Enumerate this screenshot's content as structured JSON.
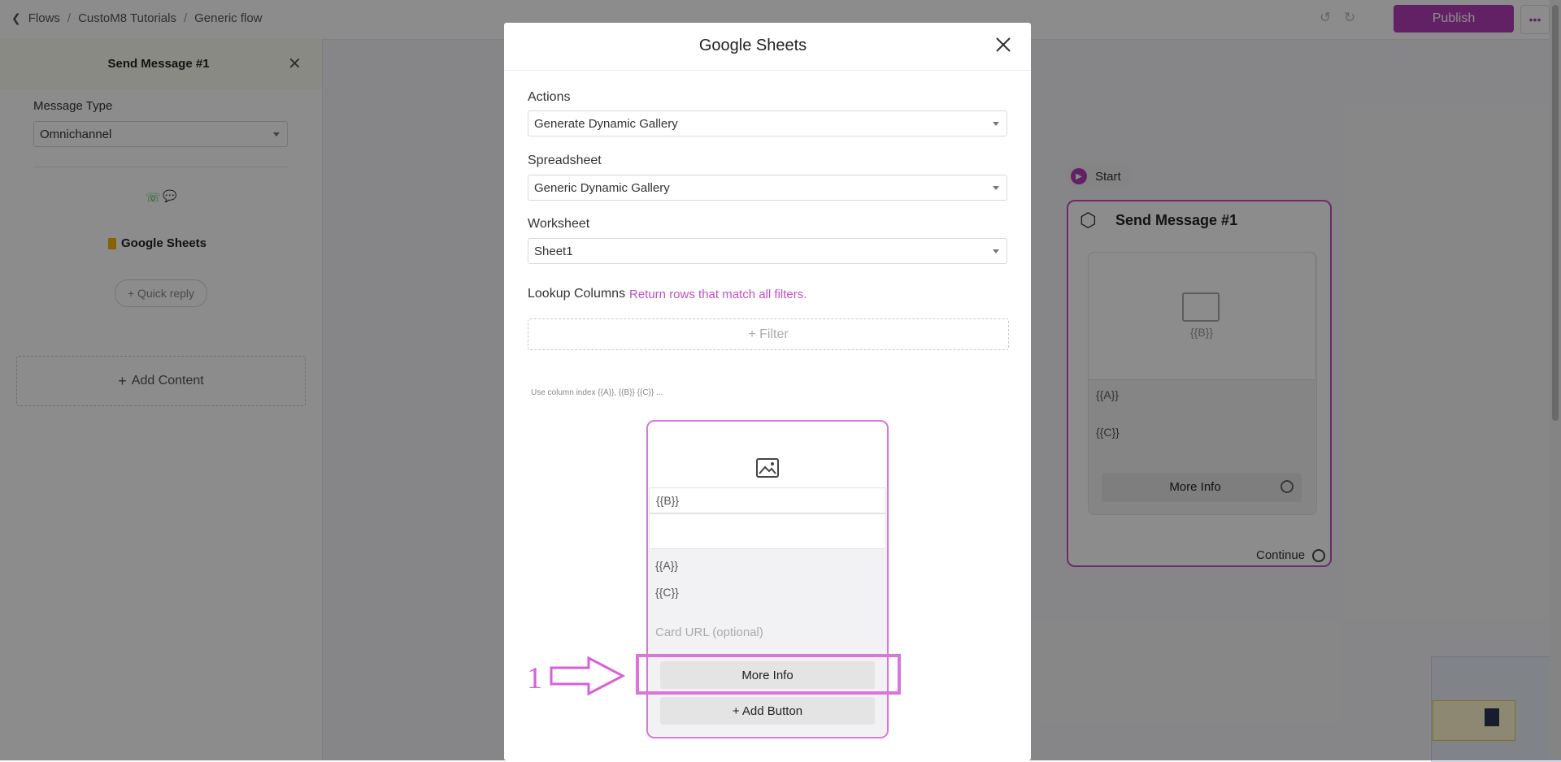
{
  "breadcrumb": {
    "flows": "Flows",
    "project": "CustoM8 Tutorials",
    "flow": "Generic flow"
  },
  "topbar": {
    "publish_label": "Publish",
    "more_label": "•••"
  },
  "left_panel": {
    "title": "Send Message #1",
    "message_type_label": "Message Type",
    "message_type_value": "Omnichannel",
    "content_title": "Google Sheets",
    "quick_reply_label": "+ Quick reply",
    "add_content_label": "Add Content"
  },
  "flow_canvas": {
    "start_label": "Start",
    "node_title": "Send Message #1",
    "image_placeholder": "{{B}}",
    "field_a": "{{A}}",
    "field_c": "{{C}}",
    "button_label": "More Info",
    "continue_label": "Continue"
  },
  "modal": {
    "title": "Google Sheets",
    "actions_label": "Actions",
    "actions_value": "Generate Dynamic Gallery",
    "spreadsheet_label": "Spreadsheet",
    "spreadsheet_value": "Generic Dynamic Gallery",
    "worksheet_label": "Worksheet",
    "worksheet_value": "Sheet1",
    "lookup_label": "Lookup Columns",
    "lookup_hint": "Return rows that match all filters.",
    "filter_label": "+ Filter",
    "column_hint": "Use column index {{A}}, {{B}} {{C}} ...",
    "card": {
      "image_field": "{{B}}",
      "field_a": "{{A}}",
      "field_c": "{{C}}",
      "card_url_placeholder": "Card URL (optional)",
      "button_label": "More Info",
      "add_button_label": "+ Add Button"
    }
  },
  "annotation": {
    "step_number": "1"
  },
  "colors": {
    "accent": "#b43db8",
    "highlight": "#dc74de"
  }
}
